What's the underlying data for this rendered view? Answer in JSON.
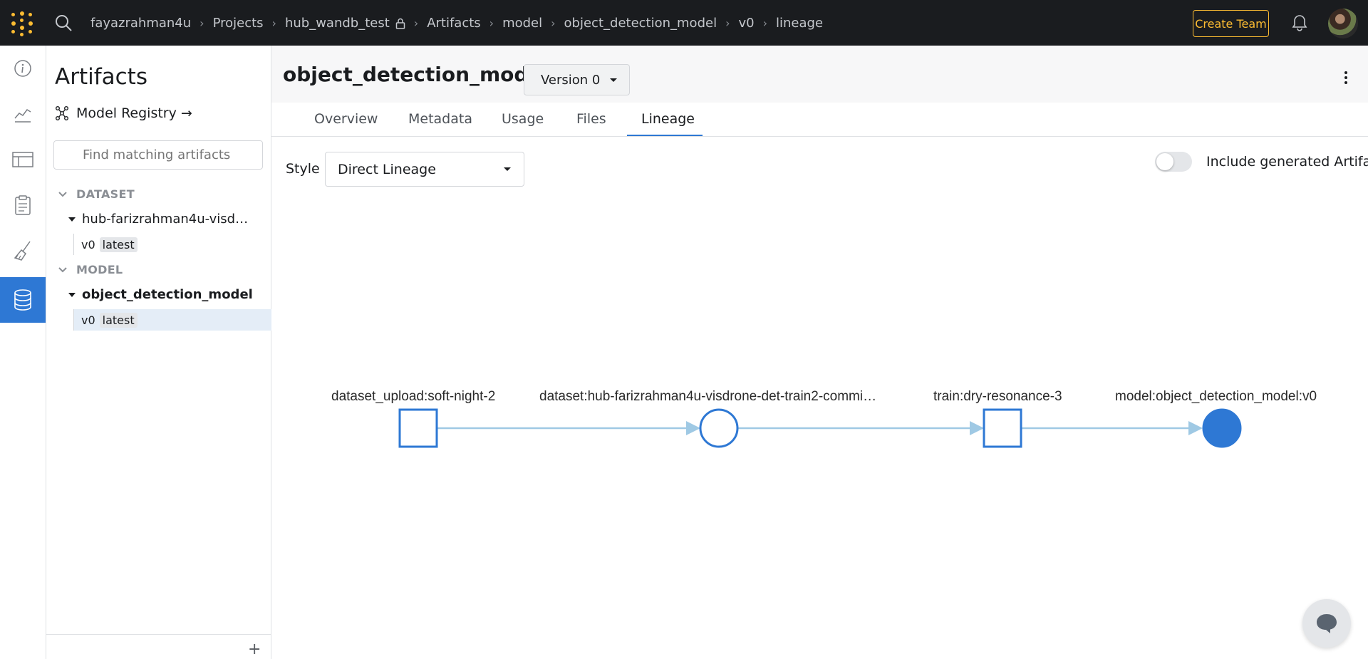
{
  "topbar": {
    "breadcrumbs": [
      "fayazrahman4u",
      "Projects",
      "hub_wandb_test",
      "Artifacts",
      "model",
      "object_detection_model",
      "v0",
      "lineage"
    ],
    "create_team": "Create Team"
  },
  "sidebar": {
    "title": "Artifacts",
    "registry_link": "Model Registry →",
    "search_placeholder": "Find matching artifacts",
    "sections": [
      {
        "name": "DATASET",
        "collection": "hub-farizrahman4u-visd…",
        "version": "v0",
        "tag": "latest"
      },
      {
        "name": "MODEL",
        "collection": "object_detection_model",
        "version": "v0",
        "tag": "latest"
      }
    ]
  },
  "main": {
    "artifact_name": "object_detection_model",
    "version_label": "Version 0",
    "tabs": [
      "Overview",
      "Metadata",
      "Usage",
      "Files",
      "Lineage"
    ],
    "active_tab": "Lineage",
    "style_label": "Style",
    "style_value": "Direct Lineage",
    "include_generated": "Include generated Artifacts"
  },
  "lineage": {
    "nodes": [
      {
        "label": "dataset_upload:soft-night-2",
        "kind": "run"
      },
      {
        "label": "dataset:hub-farizrahman4u-visdrone-det-train2-commi…",
        "kind": "artifact"
      },
      {
        "label": "train:dry-resonance-3",
        "kind": "run"
      },
      {
        "label": "model:object_detection_model:v0",
        "kind": "artifact-current"
      }
    ]
  },
  "colors": {
    "accent": "#2e78d4",
    "brand_yellow": "#fcbc32",
    "edge": "#9fc9e4"
  }
}
